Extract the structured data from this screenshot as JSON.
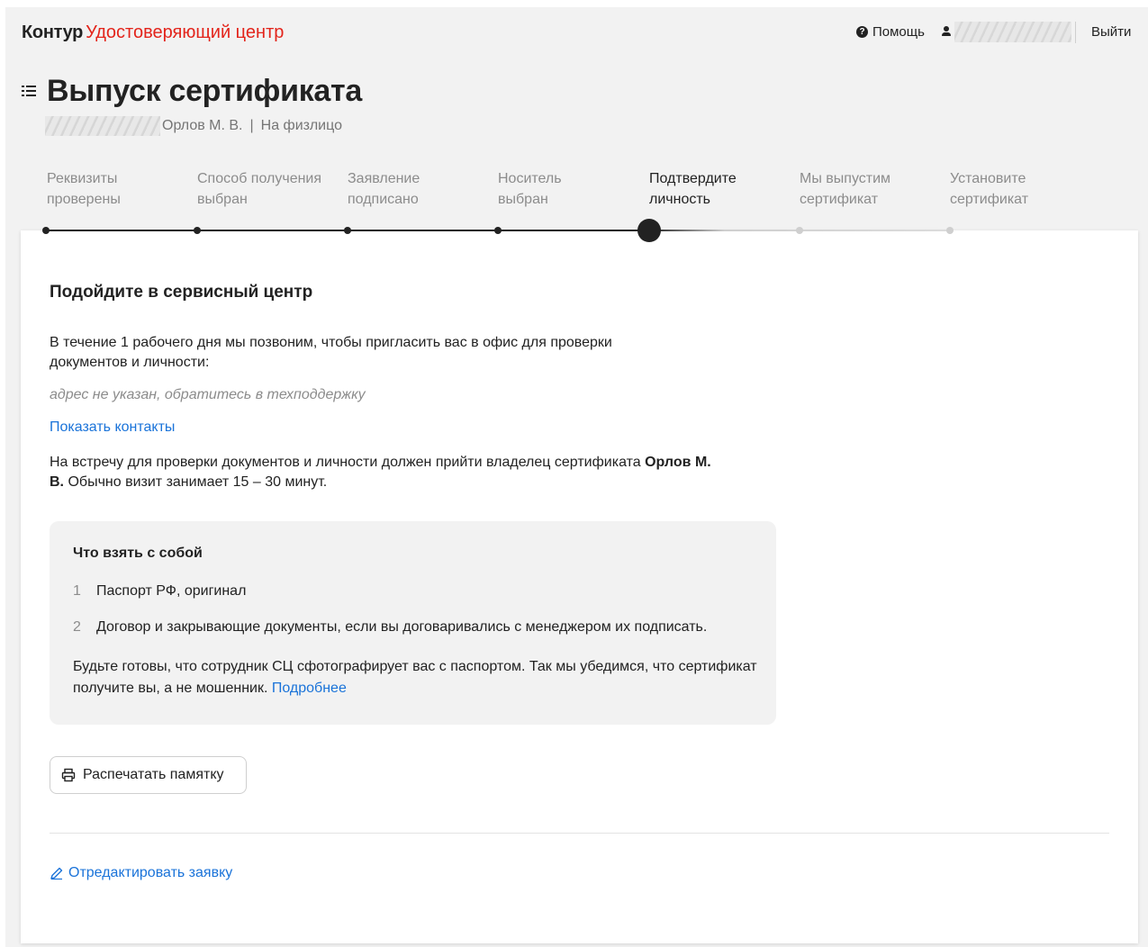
{
  "header": {
    "brand_main": "Контур",
    "brand_product": "Удостоверяющий центр",
    "help_label": "Помощь",
    "logout_label": "Выйти"
  },
  "page": {
    "title": "Выпуск сертификата",
    "owner_name": "Орлов М. В.",
    "separator": "|",
    "owner_type": "На физлицо"
  },
  "stepper": {
    "current_index": 4,
    "steps": [
      {
        "line1": "Реквизиты",
        "line2": "проверены",
        "state": "done"
      },
      {
        "line1": "Способ получения",
        "line2": "выбран",
        "state": "done"
      },
      {
        "line1": "Заявление",
        "line2": "подписано",
        "state": "done"
      },
      {
        "line1": "Носитель",
        "line2": "выбран",
        "state": "done"
      },
      {
        "line1": "Подтвердите",
        "line2": "личность",
        "state": "current"
      },
      {
        "line1": "Мы выпустим",
        "line2": "сертификат",
        "state": "upcoming"
      },
      {
        "line1": "Установите",
        "line2": "сертификат",
        "state": "upcoming"
      }
    ]
  },
  "content": {
    "heading": "Подойдите в сервисный центр",
    "intro": "В течение 1 рабочего дня мы позвоним, чтобы пригласить вас в офис для проверки документов и личности:",
    "address_missing": "адрес не указан, обратитесь в техподдержку",
    "show_contacts": "Показать контакты",
    "meeting_text_1": "На встречу для проверки документов и личности должен прийти владелец сертификата",
    "meeting_owner": "Орлов М. В.",
    "meeting_text_2": "Обычно визит занимает 15 – 30 минут."
  },
  "checklist": {
    "title": "Что взять с собой",
    "items": [
      {
        "num": "1",
        "text": "Паспорт РФ, оригинал"
      },
      {
        "num": "2",
        "text": "Договор и закрывающие документы, если вы договаривались с менеджером их подписать."
      }
    ],
    "note": "Будьте готовы, что сотрудник СЦ сфотографирует вас с паспортом. Так мы убедимся, что сертификат получите вы, а не мошенник.",
    "more_link": "Подробнее"
  },
  "actions": {
    "print_label": "Распечатать памятку",
    "edit_label": "Отредактировать заявку"
  },
  "colors": {
    "brand_red": "#e3241b",
    "link_blue": "#1a73d9",
    "text": "#222222",
    "muted": "#8c8c8c"
  },
  "icons": {
    "help": "question-circle-icon",
    "user": "user-icon",
    "menu": "list-icon",
    "print": "printer-icon",
    "edit": "pencil-icon"
  }
}
